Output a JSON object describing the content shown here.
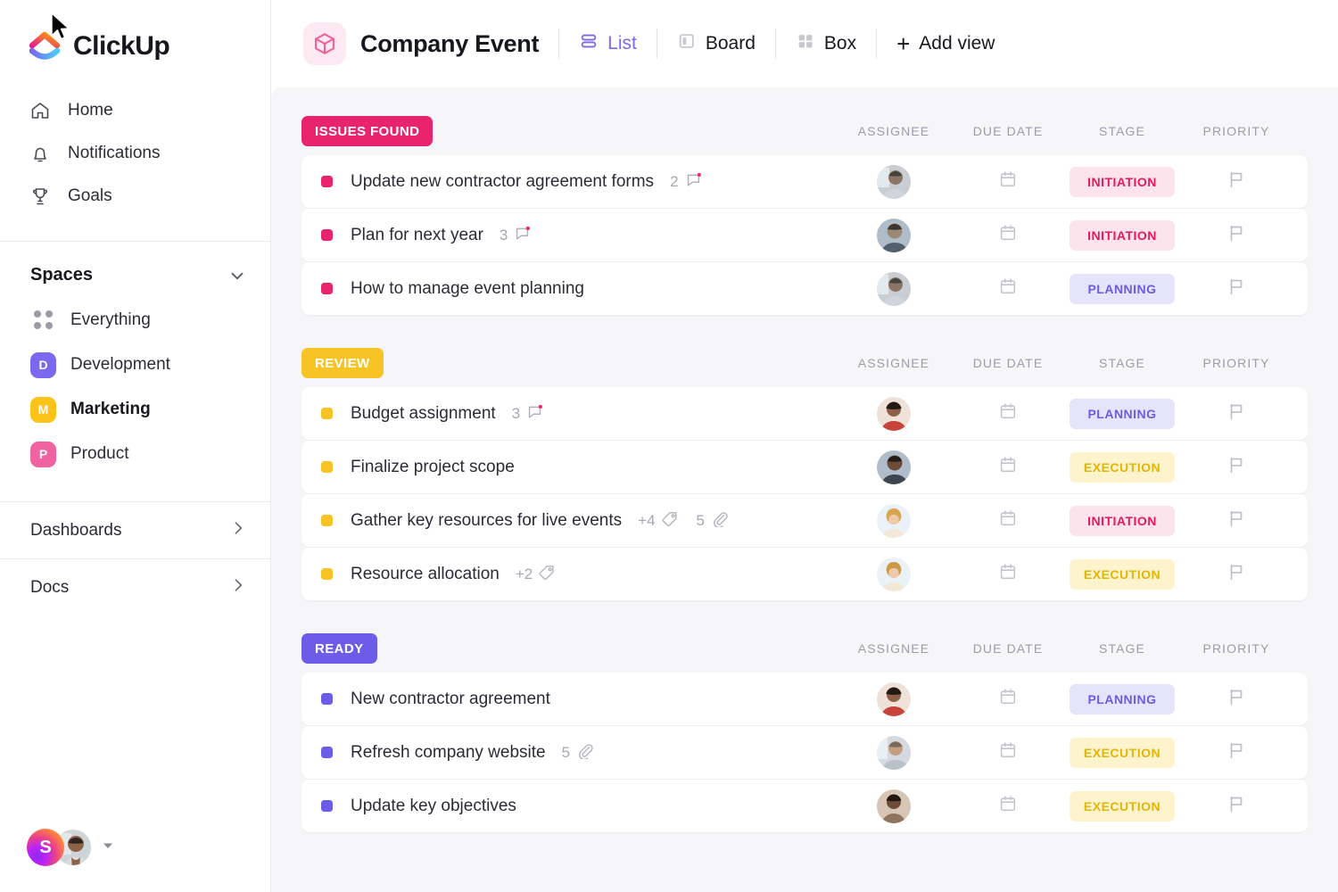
{
  "brand": {
    "name": "ClickUp",
    "logo_icon": "clickup-logo-icon"
  },
  "sidebar": {
    "nav": [
      {
        "label": "Home",
        "icon": "home-icon"
      },
      {
        "label": "Notifications",
        "icon": "bell-icon"
      },
      {
        "label": "Goals",
        "icon": "trophy-icon"
      }
    ],
    "spaces_title": "Spaces",
    "spaces_chevron_icon": "chevron-down-icon",
    "spaces": [
      {
        "label": "Everything",
        "icon": "grid-dots-icon",
        "initial": "",
        "color": ""
      },
      {
        "label": "Development",
        "icon": "space-badge",
        "initial": "D",
        "color": "#7b68ee"
      },
      {
        "label": "Marketing",
        "icon": "space-badge",
        "initial": "M",
        "color": "#fcc419",
        "active": true
      },
      {
        "label": "Product",
        "icon": "space-badge",
        "initial": "P",
        "color": "#f062a0"
      }
    ],
    "bottom_links": [
      {
        "label": "Dashboards",
        "icon": "chevron-right-icon"
      },
      {
        "label": "Docs",
        "icon": "chevron-right-icon"
      }
    ],
    "user_tray": {
      "workspace_initial": "S",
      "avatar_icon": "user-avatar",
      "chevron_icon": "caret-down-icon"
    }
  },
  "topbar": {
    "list_icon": "cube-icon",
    "title": "Company Event",
    "views": [
      {
        "label": "List",
        "icon": "list-view-icon",
        "active": true
      },
      {
        "label": "Board",
        "icon": "board-view-icon",
        "active": false
      },
      {
        "label": "Box",
        "icon": "box-view-icon",
        "active": false
      }
    ],
    "add_view": {
      "label": "Add view",
      "icon": "plus-icon"
    }
  },
  "columns": {
    "assignee": "ASSIGNEE",
    "due_date": "DUE DATE",
    "stage": "STAGE",
    "priority": "PRIORITY"
  },
  "groups": [
    {
      "name": "ISSUES FOUND",
      "color": "#e8246f",
      "dot_color": "#e8246f",
      "tasks": [
        {
          "name": "Update new contractor agreement forms",
          "comments": "2",
          "comment_icon": "comment-icon",
          "comment_unread": true,
          "tags": "",
          "attachments": "",
          "assignee_avatar": "avatar-1",
          "avatar_tone": "#8a8f96",
          "due_icon": "calendar-icon",
          "stage": "INITIATION",
          "priority_icon": "flag-icon"
        },
        {
          "name": "Plan for next year",
          "comments": "3",
          "comment_icon": "comment-icon",
          "comment_unread": true,
          "tags": "",
          "attachments": "",
          "assignee_avatar": "avatar-2",
          "avatar_tone": "#7d8c9e",
          "due_icon": "calendar-icon",
          "stage": "INITIATION",
          "priority_icon": "flag-icon"
        },
        {
          "name": "How to manage event planning",
          "comments": "",
          "comment_icon": "",
          "comment_unread": false,
          "tags": "",
          "attachments": "",
          "assignee_avatar": "avatar-3",
          "avatar_tone": "#8a8f96",
          "due_icon": "calendar-icon",
          "stage": "PLANNING",
          "priority_icon": "flag-icon"
        }
      ]
    },
    {
      "name": "REVIEW",
      "color": "#f7c325",
      "dot_color": "#f7c325",
      "tasks": [
        {
          "name": "Budget assignment",
          "comments": "3",
          "comment_icon": "comment-icon",
          "comment_unread": true,
          "tags": "",
          "attachments": "",
          "assignee_avatar": "avatar-4",
          "avatar_tone": "#b5564a",
          "due_icon": "calendar-icon",
          "stage": "PLANNING",
          "priority_icon": "flag-icon"
        },
        {
          "name": "Finalize project scope",
          "comments": "",
          "comment_icon": "",
          "comment_unread": false,
          "tags": "",
          "attachments": "",
          "assignee_avatar": "avatar-5",
          "avatar_tone": "#6e7e8c",
          "due_icon": "calendar-icon",
          "stage": "EXECUTION",
          "priority_icon": "flag-icon",
          "cursor_here": true
        },
        {
          "name": "Gather key resources for live events",
          "comments": "",
          "comment_icon": "",
          "comment_unread": false,
          "tags": "+4",
          "tag_icon": "tag-icon",
          "attachments": "5",
          "attachment_icon": "paperclip-icon",
          "assignee_avatar": "avatar-6",
          "avatar_tone": "#d8c3a5",
          "due_icon": "calendar-icon",
          "stage": "INITIATION",
          "priority_icon": "flag-icon"
        },
        {
          "name": "Resource allocation",
          "comments": "",
          "comment_icon": "",
          "comment_unread": false,
          "tags": "+2",
          "tag_icon": "tag-icon",
          "attachments": "",
          "assignee_avatar": "avatar-7",
          "avatar_tone": "#d8c3a5",
          "due_icon": "calendar-icon",
          "stage": "EXECUTION",
          "priority_icon": "flag-icon"
        }
      ]
    },
    {
      "name": "READY",
      "color": "#6c5ce7",
      "dot_color": "#6c5ce7",
      "tasks": [
        {
          "name": "New contractor agreement",
          "comments": "",
          "comment_icon": "",
          "comment_unread": false,
          "tags": "",
          "attachments": "",
          "assignee_avatar": "avatar-8",
          "avatar_tone": "#b5564a",
          "due_icon": "calendar-icon",
          "stage": "PLANNING",
          "priority_icon": "flag-icon"
        },
        {
          "name": "Refresh company website",
          "comments": "",
          "comment_icon": "",
          "comment_unread": false,
          "tags": "",
          "attachments": "5",
          "attachment_icon": "paperclip-icon",
          "assignee_avatar": "avatar-9",
          "avatar_tone": "#9aa3ad",
          "due_icon": "calendar-icon",
          "stage": "EXECUTION",
          "priority_icon": "flag-icon"
        },
        {
          "name": "Update key objectives",
          "comments": "",
          "comment_icon": "",
          "comment_unread": false,
          "tags": "",
          "attachments": "",
          "assignee_avatar": "avatar-10",
          "avatar_tone": "#7a5c4a",
          "due_icon": "calendar-icon",
          "stage": "EXECUTION",
          "priority_icon": "flag-icon"
        }
      ]
    }
  ]
}
